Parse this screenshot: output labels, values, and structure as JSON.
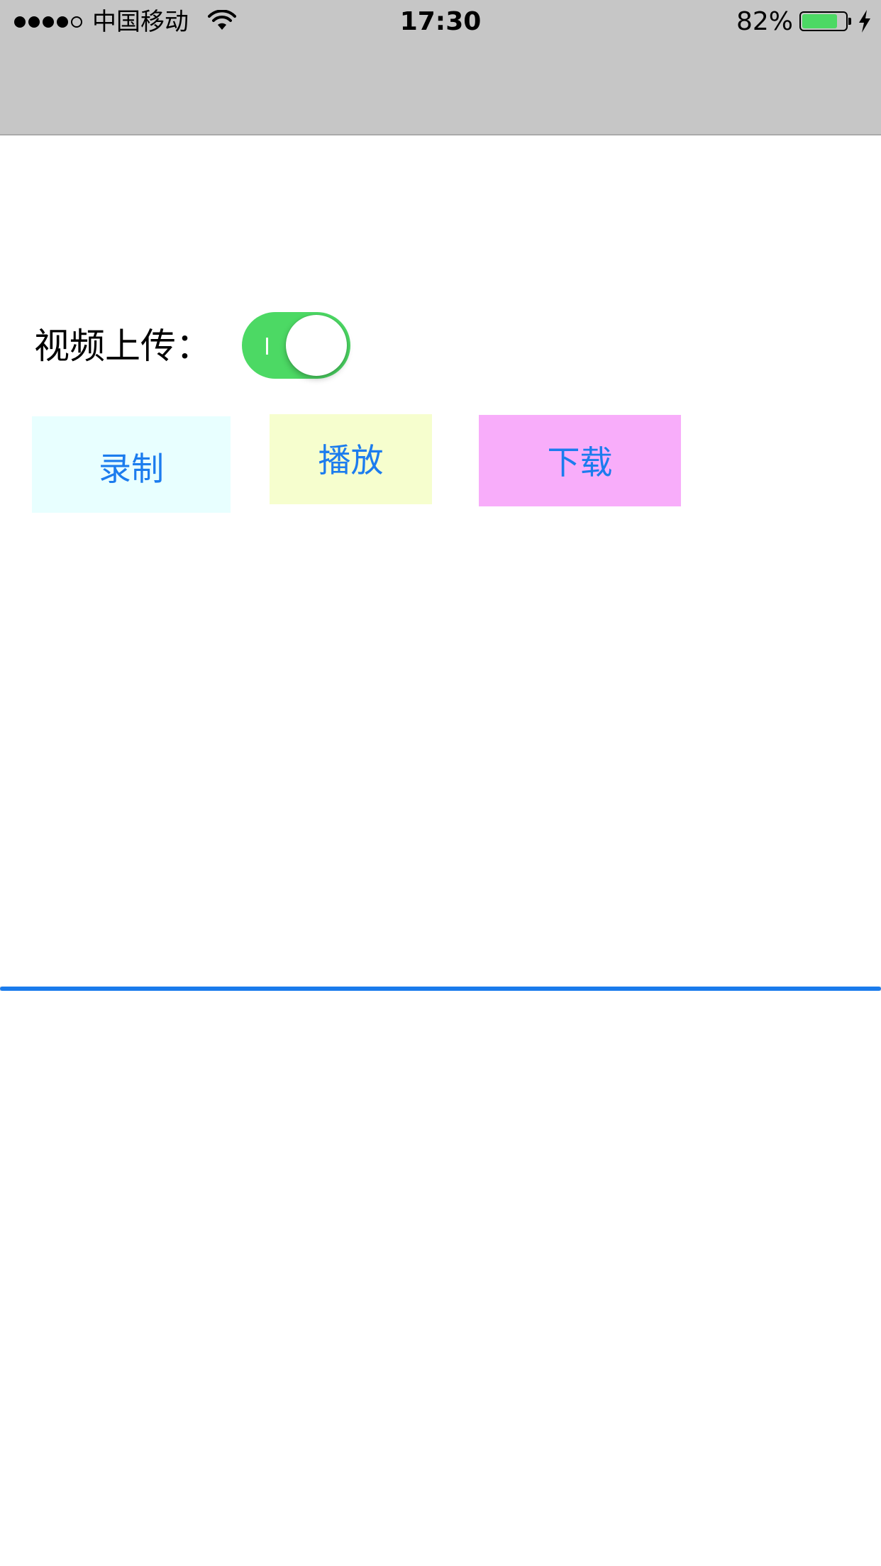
{
  "status_bar": {
    "signal_filled": 4,
    "signal_total": 5,
    "carrier": "中国移动",
    "time": "17:30",
    "battery_percent": "82%",
    "battery_level": 0.82,
    "battery_color": "#4cd964",
    "icons": [
      "signal-icon",
      "wifi-icon",
      "battery-icon",
      "charging-bolt-icon"
    ]
  },
  "upload": {
    "label": "视频上传：",
    "toggle_on": true,
    "toggle_color": "#4cd964"
  },
  "buttons": {
    "record": {
      "label": "录制",
      "background": "#e8ffff"
    },
    "play": {
      "label": "播放",
      "background": "#f6fece"
    },
    "download": {
      "label": "下载",
      "background": "#f8adfa"
    },
    "text_color": "#1c7cee"
  },
  "progress": {
    "value": 1.0,
    "tint": "#1a7bec"
  }
}
